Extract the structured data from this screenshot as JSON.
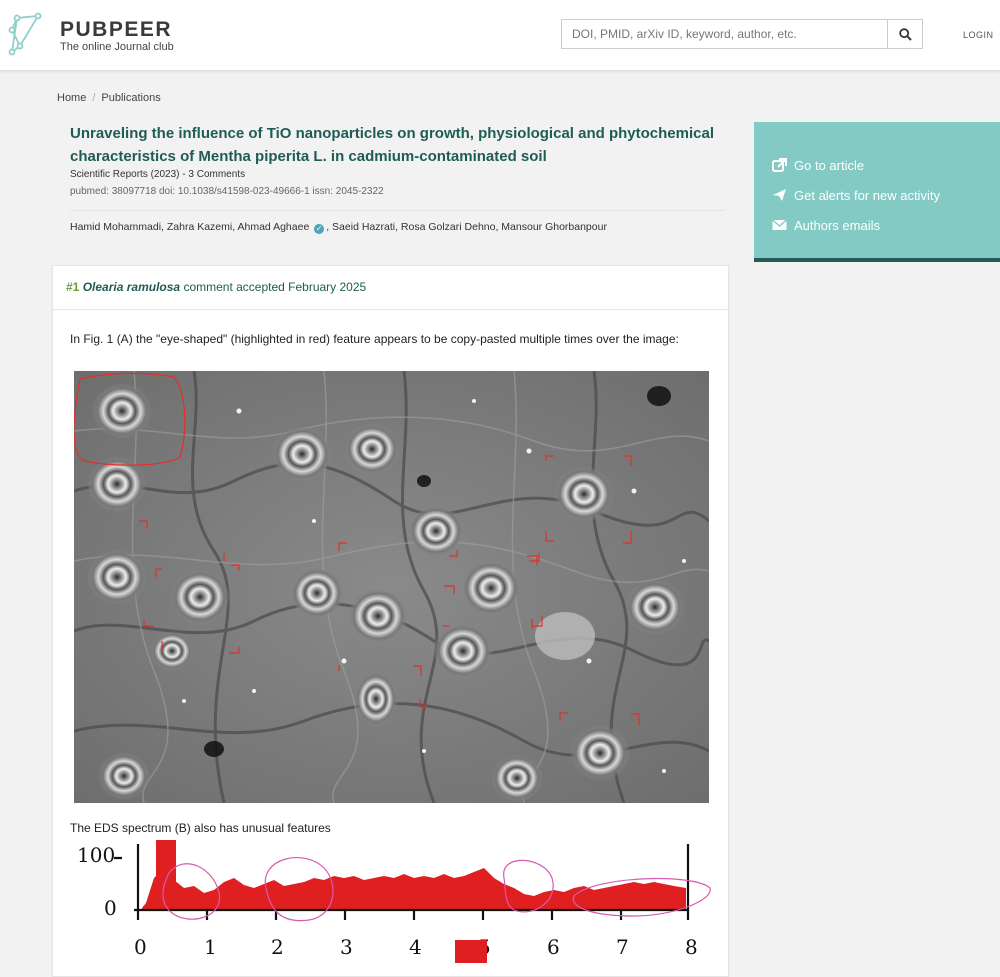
{
  "header": {
    "brand": "PUBPEER",
    "tagline": "The online Journal club",
    "search_placeholder": "DOI, PMID, arXiv ID, keyword, author, etc.",
    "search_icon": "search-icon",
    "login_label": "LOGIN"
  },
  "breadcrumb": {
    "home": "Home",
    "separator": "/",
    "current": "Publications"
  },
  "publication": {
    "title": "Unraveling the influence of TiO nanoparticles on growth, physiological and phytochemical characteristics of Mentha piperita L. in cadmium-contaminated soil",
    "journal_line": "Scientific Reports (2023) - 3 Comments",
    "ids_line": "pubmed: 38097718  doi: 10.1038/s41598-023-49666-1  issn: 2045-2322",
    "authors_before": "Hamid Mohammadi, Zahra Kazemi, Ahmad Aghaee",
    "authors_after": ", Saeid Hazrati, Rosa Golzari Dehno, Mansour Ghorbanpour"
  },
  "sidebar": {
    "items": [
      {
        "label": "Go to article",
        "icon": "external-link-icon"
      },
      {
        "label": "Get alerts for new activity",
        "icon": "paper-plane-icon"
      },
      {
        "label": "Authors emails",
        "icon": "envelope-icon"
      }
    ],
    "background": "#83c9c4",
    "border": "#265a56"
  },
  "comment": {
    "number": "#1",
    "user": "Olearia ramulosa",
    "status": "comment accepted February 2025",
    "text1": "In Fig. 1 (A) the \"eye-shaped\" (highlighted in red) feature appears to be copy-pasted multiple times over the image:",
    "text2": "The EDS spectrum (B) also has unusual features"
  },
  "eds_axis": {
    "y_ticks": [
      "100",
      "0"
    ],
    "x_ticks": [
      "0",
      "1",
      "2",
      "3",
      "4",
      "5",
      "6",
      "7",
      "8"
    ]
  },
  "colors": {
    "title": "#1f5c55",
    "highlight_red": "#e02020",
    "annotation_pink": "#d85ab0"
  }
}
